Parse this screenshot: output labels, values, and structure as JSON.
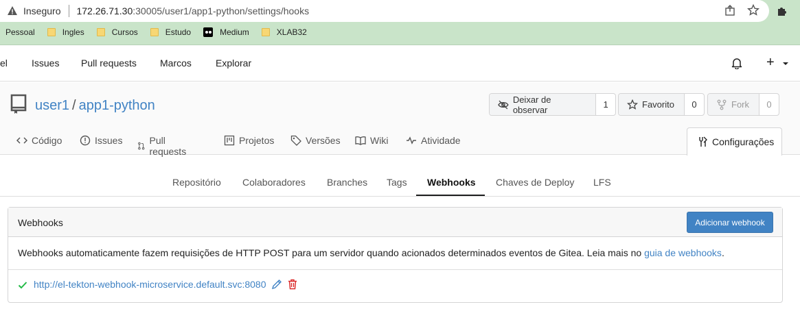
{
  "browser": {
    "security_label": "Inseguro",
    "url_host": "172.26.71.30",
    "url_rest": ":30005/user1/app1-python/settings/hooks",
    "bookmarks": [
      "Pessoal",
      "Ingles",
      "Cursos",
      "Estudo",
      "Medium",
      "XLAB32"
    ]
  },
  "topnav": {
    "items": [
      "el",
      "Issues",
      "Pull requests",
      "Marcos",
      "Explorar"
    ]
  },
  "repo": {
    "owner": "user1",
    "separator": "/",
    "name": "app1-python",
    "watch": {
      "label": "Deixar de observar",
      "count": "1"
    },
    "star": {
      "label": "Favorito",
      "count": "0"
    },
    "fork": {
      "label": "Fork",
      "count": "0"
    }
  },
  "tabs": {
    "items": [
      "Código",
      "Issues",
      "Pull requests",
      "Projetos",
      "Versões",
      "Wiki",
      "Atividade"
    ],
    "active": "Configurações"
  },
  "settings_menu": {
    "items": [
      "Repositório",
      "Colaboradores",
      "Branches",
      "Tags",
      "Webhooks",
      "Chaves de Deploy",
      "LFS"
    ],
    "active_index": 4
  },
  "webhooks": {
    "title": "Webhooks",
    "add_button": "Adicionar webhook",
    "description": "Webhooks automaticamente fazem requisições de HTTP POST para um servidor quando acionados determinados eventos de Gitea. Leia mais no ",
    "guide_link": "guia de webhooks",
    "description_end": ".",
    "hooks": [
      {
        "url": "http://el-tekton-webhook-microservice.default.svc:8080",
        "status": "ok"
      }
    ]
  },
  "colors": {
    "link": "#4183c4",
    "primary_button": "#4183c4",
    "success": "#21ba45",
    "danger": "#db2828",
    "chrome_green": "#c9e4c9"
  }
}
